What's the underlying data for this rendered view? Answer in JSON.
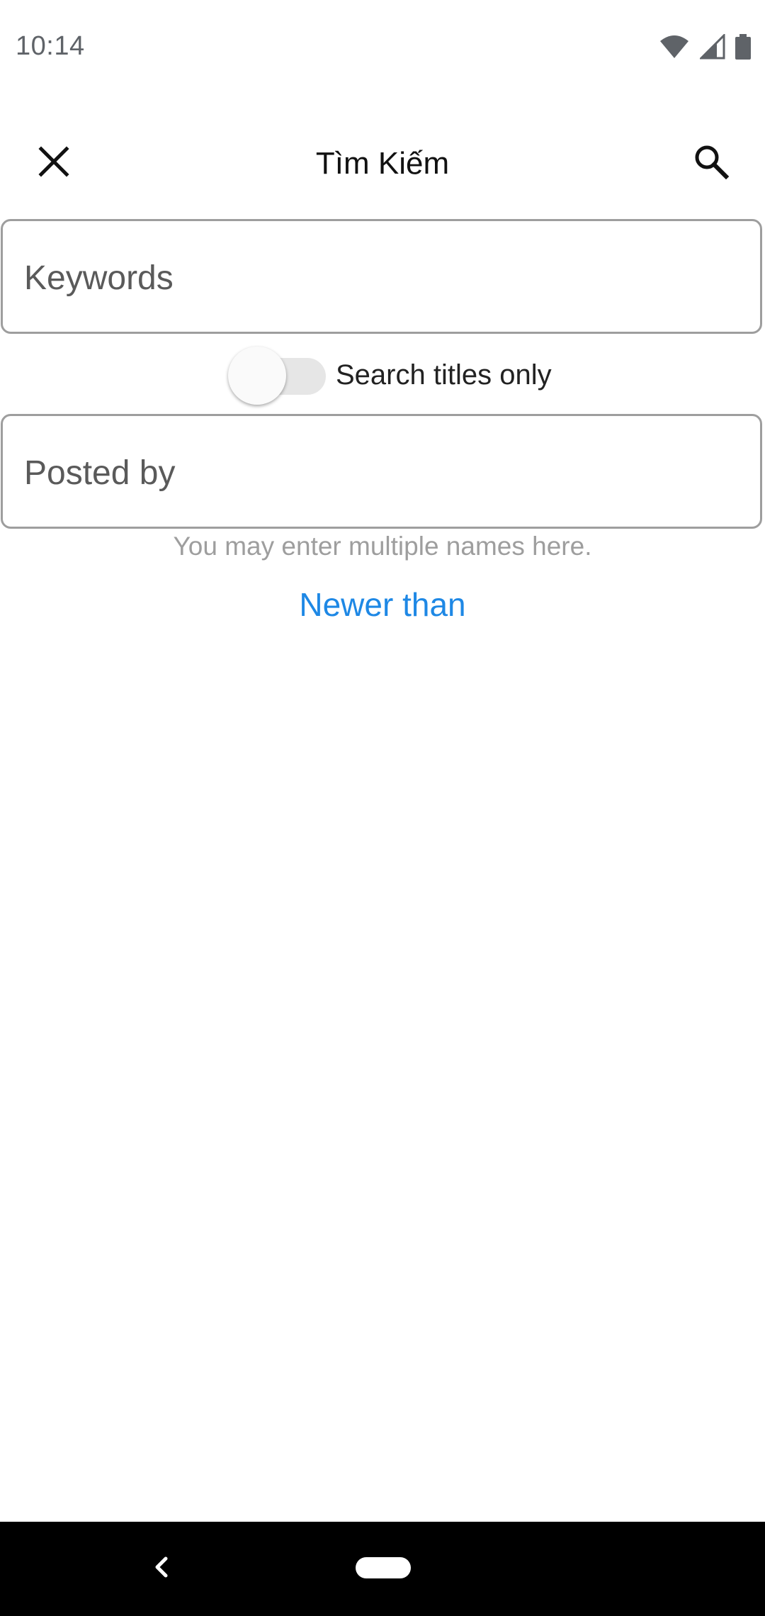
{
  "status_bar": {
    "time": "10:14",
    "icons": [
      "wifi-icon",
      "cell-signal-icon",
      "battery-icon"
    ]
  },
  "toolbar": {
    "title": "Tìm Kiếm",
    "close_icon": "close-icon",
    "search_icon": "search-icon"
  },
  "form": {
    "keywords": {
      "placeholder": "Keywords",
      "value": ""
    },
    "search_titles_only": {
      "label": "Search titles only",
      "enabled": false
    },
    "posted_by": {
      "placeholder": "Posted by",
      "value": ""
    },
    "posted_by_helper": "You may enter multiple names here.",
    "newer_than_label": "Newer than"
  },
  "colors": {
    "link": "#1e88e5",
    "field_border": "#9e9e9e",
    "helper_text": "#9e9e9e",
    "nav_bar": "#000000"
  },
  "nav_bar": {
    "back_icon": "back-chevron-icon",
    "home_icon": "home-pill-icon"
  }
}
